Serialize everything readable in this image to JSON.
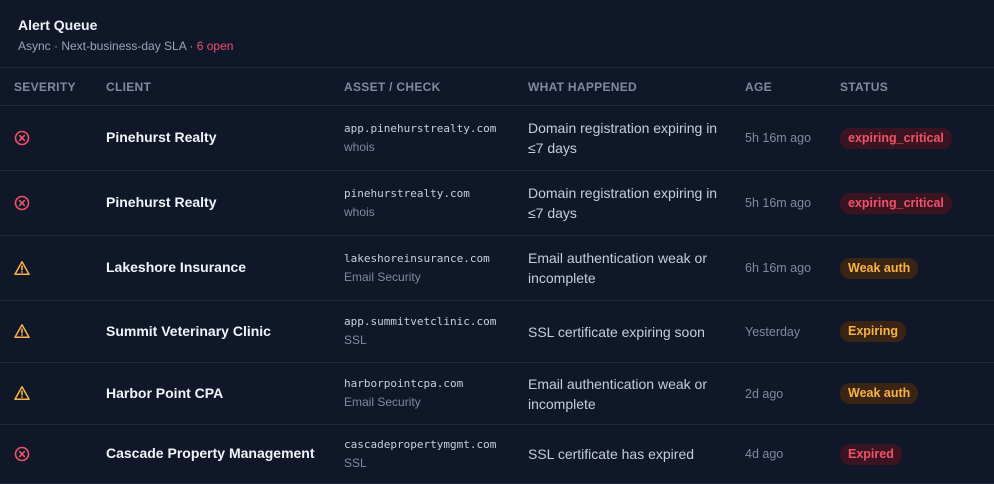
{
  "header": {
    "title": "Alert Queue",
    "subtitle_prefix": "Async · Next-business-day SLA · ",
    "open_count": "6 open"
  },
  "columns": {
    "severity": "SEVERITY",
    "client": "CLIENT",
    "asset": "ASSET / CHECK",
    "what": "WHAT HAPPENED",
    "age": "AGE",
    "status": "STATUS"
  },
  "colors": {
    "critical": "#f0526a",
    "warning": "#f8b347"
  },
  "rows": [
    {
      "severity": "critical",
      "severity_icon": "x-circle-icon",
      "client": "Pinehurst Realty",
      "asset": "app.pinehurstrealty.com",
      "check": "whois",
      "what": "Domain registration expiring in ≤7 days",
      "age": "5h 16m ago",
      "status": "expiring_critical",
      "status_tone": "critical"
    },
    {
      "severity": "critical",
      "severity_icon": "x-circle-icon",
      "client": "Pinehurst Realty",
      "asset": "pinehurstrealty.com",
      "check": "whois",
      "what": "Domain registration expiring in ≤7 days",
      "age": "5h 16m ago",
      "status": "expiring_critical",
      "status_tone": "critical"
    },
    {
      "severity": "warning",
      "severity_icon": "warning-triangle-icon",
      "client": "Lakeshore Insurance",
      "asset": "lakeshoreinsurance.com",
      "check": "Email Security",
      "what": "Email authentication weak or incomplete",
      "age": "6h 16m ago",
      "status": "Weak auth",
      "status_tone": "warn"
    },
    {
      "severity": "warning",
      "severity_icon": "warning-triangle-icon",
      "client": "Summit Veterinary Clinic",
      "asset": "app.summitvetclinic.com",
      "check": "SSL",
      "what": "SSL certificate expiring soon",
      "age": "Yesterday",
      "status": "Expiring",
      "status_tone": "warn"
    },
    {
      "severity": "warning",
      "severity_icon": "warning-triangle-icon",
      "client": "Harbor Point CPA",
      "asset": "harborpointcpa.com",
      "check": "Email Security",
      "what": "Email authentication weak or incomplete",
      "age": "2d ago",
      "status": "Weak auth",
      "status_tone": "warn"
    },
    {
      "severity": "critical",
      "severity_icon": "x-circle-icon",
      "client": "Cascade Property Management",
      "asset": "cascadepropertymgmt.com",
      "check": "SSL",
      "what": "SSL certificate has expired",
      "age": "4d ago",
      "status": "Expired",
      "status_tone": "critical"
    }
  ]
}
